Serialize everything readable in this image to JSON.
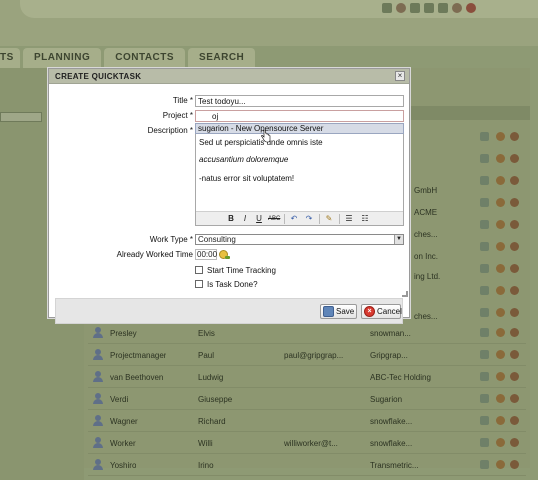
{
  "nav": {
    "tabs": [
      "TS",
      "PLANNING",
      "CONTACTS",
      "SEARCH"
    ]
  },
  "dialog": {
    "title": "CREATE QUICKTASK",
    "close_label": "×",
    "fields": {
      "title_label": "Title *",
      "title_value": "Test todoyu...",
      "project_label": "Project *",
      "project_value": "oj",
      "project_suggestion": "sugarion - New Opensource Server",
      "description_label": "Description *",
      "description_lines": [
        "Sed ut perspiciatis unde omnis iste",
        "accusantium doloremque",
        "-natus error sit voluptatem!"
      ],
      "worktype_label": "Work Type *",
      "worktype_value": "Consulting",
      "worked_label": "Already Worked Time",
      "worked_value": "00:00",
      "start_tracking_label": "Start Time Tracking",
      "task_done_label": "Is Task Done?"
    },
    "editor_toolbar": [
      "B",
      "I",
      "U",
      "ABC",
      "↶",
      "↷",
      "✎",
      "☰",
      "☷"
    ],
    "buttons": {
      "save": "Save",
      "cancel": "Cancel"
    }
  },
  "grid": {
    "right_stubs": [
      "GmbH",
      "ACME",
      "ches...",
      "on Inc.",
      "ing Ltd.",
      "ches..."
    ],
    "rows": [
      {
        "last": "Presley",
        "first": "Elvis",
        "email": "",
        "company": "snowman..."
      },
      {
        "last": "Projectmanager",
        "first": "Paul",
        "email": "paul@gripgrap...",
        "company": "Gripgrap..."
      },
      {
        "last": "van Beethoven",
        "first": "Ludwig",
        "email": "",
        "company": "ABC-Tec Holding"
      },
      {
        "last": "Verdi",
        "first": "Giuseppe",
        "email": "",
        "company": "Sugarion"
      },
      {
        "last": "Wagner",
        "first": "Richard",
        "email": "",
        "company": "snowflake..."
      },
      {
        "last": "Worker",
        "first": "Willi",
        "email": "williworker@t...",
        "company": "snowflake..."
      },
      {
        "last": "Yoshiro",
        "first": "Irino",
        "email": "",
        "company": "Transmetric..."
      }
    ]
  }
}
